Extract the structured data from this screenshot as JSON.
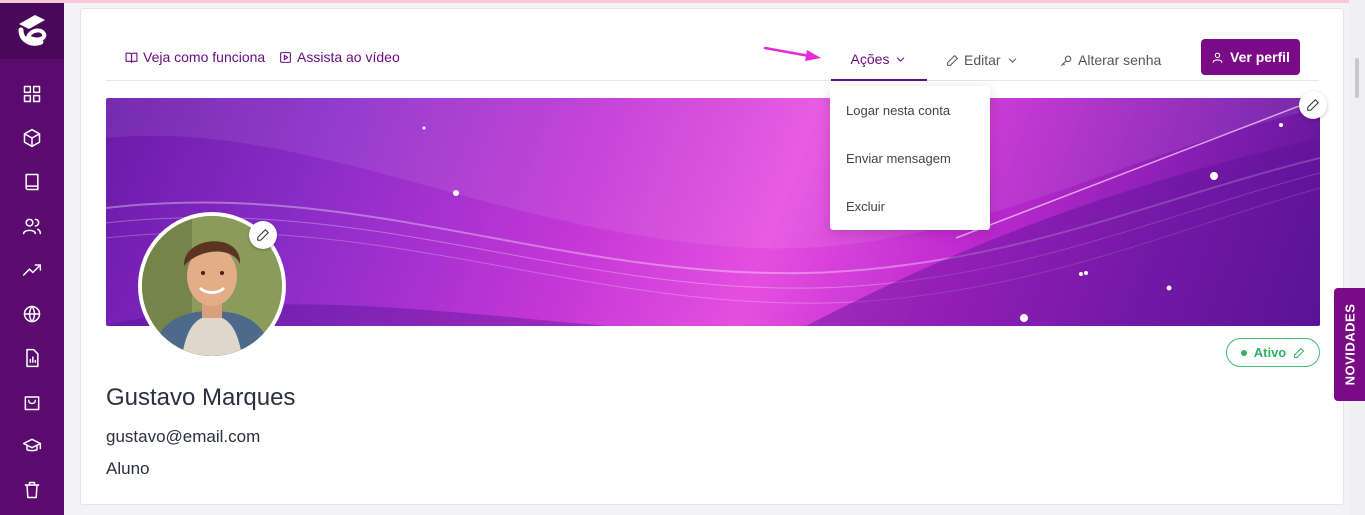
{
  "toolbar": {
    "how_it_works": "Veja como funciona",
    "watch_video": "Assista ao vídeo",
    "actions": "Ações",
    "edit": "Editar",
    "change_password": "Alterar senha",
    "view_profile": "Ver perfil"
  },
  "actions_menu": {
    "items": [
      "Logar nesta conta",
      "Enviar mensagem",
      "Excluir"
    ]
  },
  "profile": {
    "name": "Gustavo Marques",
    "email": "gustavo@email.com",
    "role": "Aluno",
    "status": "Ativo"
  },
  "side_tab": "NOVIDADES",
  "sidebar": {
    "icons": [
      "dashboard-icon",
      "box-icon",
      "book-icon",
      "users-icon",
      "trending-up-icon",
      "globe-icon",
      "report-icon",
      "shopping-bag-icon",
      "graduation-cap-icon",
      "trash-icon"
    ]
  },
  "colors": {
    "brand": "#7a0a86",
    "sidebar": "#5b0a6e",
    "status": "#2fb25f",
    "arrow": "#e62ad8"
  }
}
